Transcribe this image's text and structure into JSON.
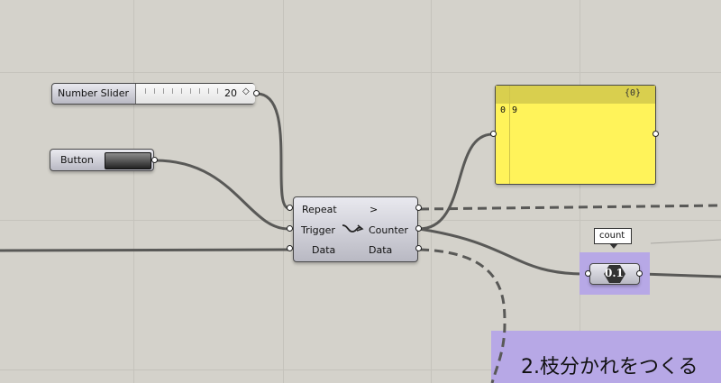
{
  "number_slider": {
    "name": "Number Slider",
    "value": "20"
  },
  "button": {
    "name": "Button"
  },
  "counter": {
    "inputs": [
      "Repeat",
      "Trigger",
      "Data"
    ],
    "outputs": [
      ">",
      "Counter",
      "Data"
    ]
  },
  "panel": {
    "header": "{0}",
    "index": "0",
    "value": "9"
  },
  "number_display": {
    "tooltip": "count",
    "value": "0.1"
  },
  "group_note": {
    "text": "2.枝分かれをつくる"
  },
  "colors": {
    "canvas_bg": "#d4d2cb",
    "panel_yellow": "#fff35a",
    "group_purple": "#b7a8e6",
    "wire": "#595957"
  }
}
